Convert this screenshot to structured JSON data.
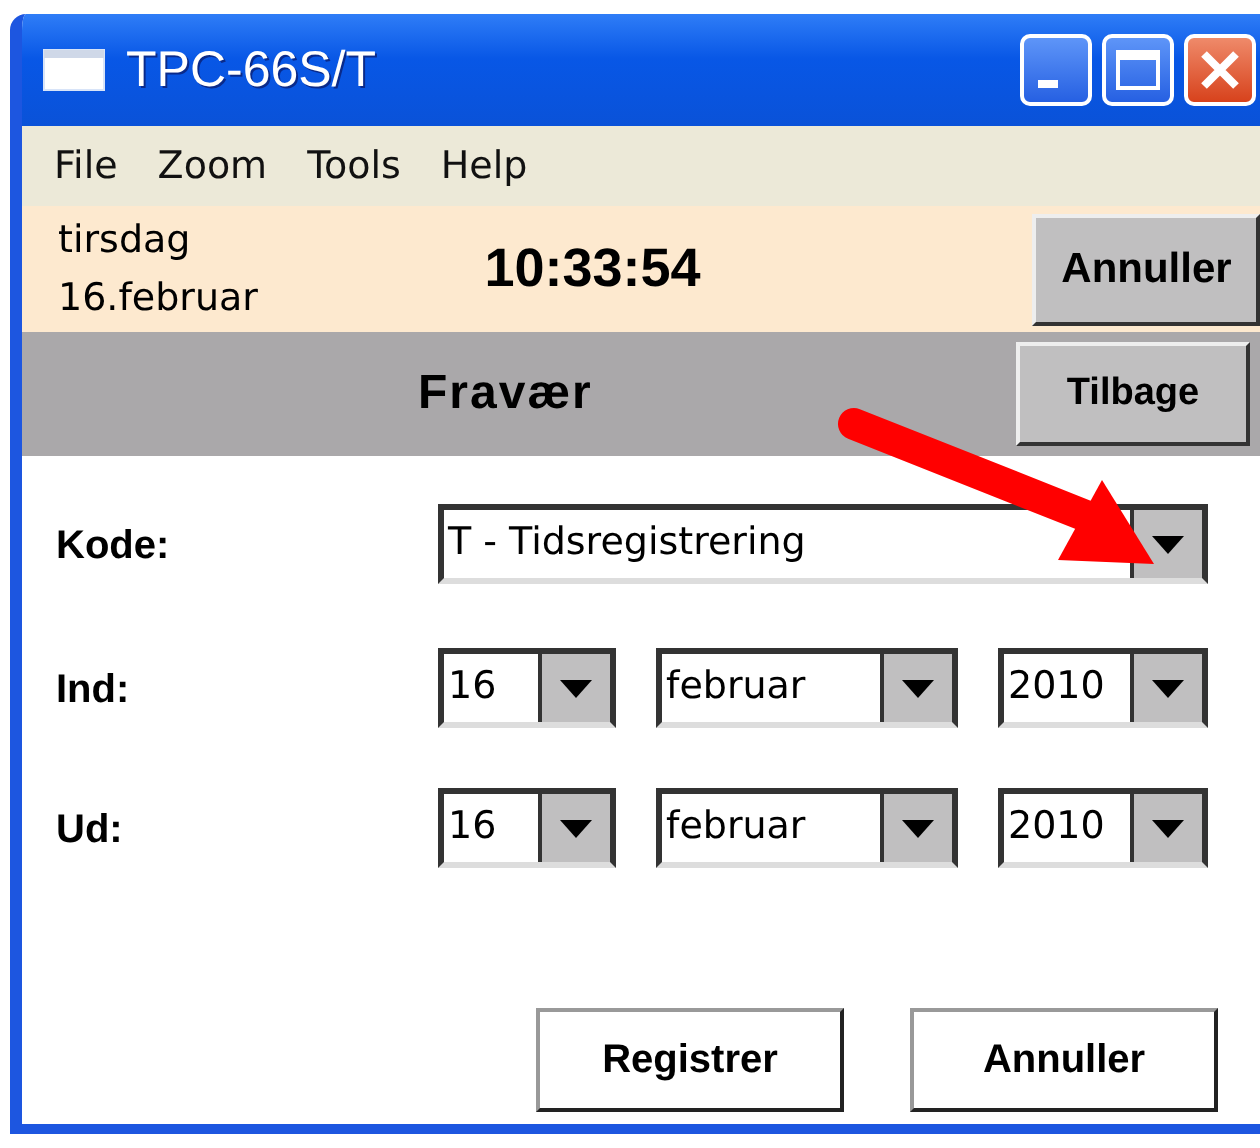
{
  "window": {
    "title": "TPC-66S/T"
  },
  "menu": [
    "File",
    "Zoom",
    "Tools",
    "Help"
  ],
  "info": {
    "weekday": "tirsdag",
    "date": "16.februar",
    "time": "10:33:54",
    "cancel_button": "Annuller"
  },
  "header": {
    "title": "Fravær",
    "back_button": "Tilbage"
  },
  "fields": [
    {
      "label": "Kode:",
      "kind": "wide",
      "combos": [
        {
          "value": "T - Tidsregistrering"
        }
      ]
    },
    {
      "label": "Ind:",
      "kind": "date",
      "combos": [
        {
          "value": "16"
        },
        {
          "value": "februar"
        },
        {
          "value": "2010"
        }
      ]
    },
    {
      "label": "Ud:",
      "kind": "date",
      "combos": [
        {
          "value": "16"
        },
        {
          "value": "februar"
        },
        {
          "value": "2010"
        }
      ]
    }
  ],
  "buttons": [
    "Registrer",
    "Annuller"
  ],
  "annotation": {
    "kind": "arrow"
  }
}
